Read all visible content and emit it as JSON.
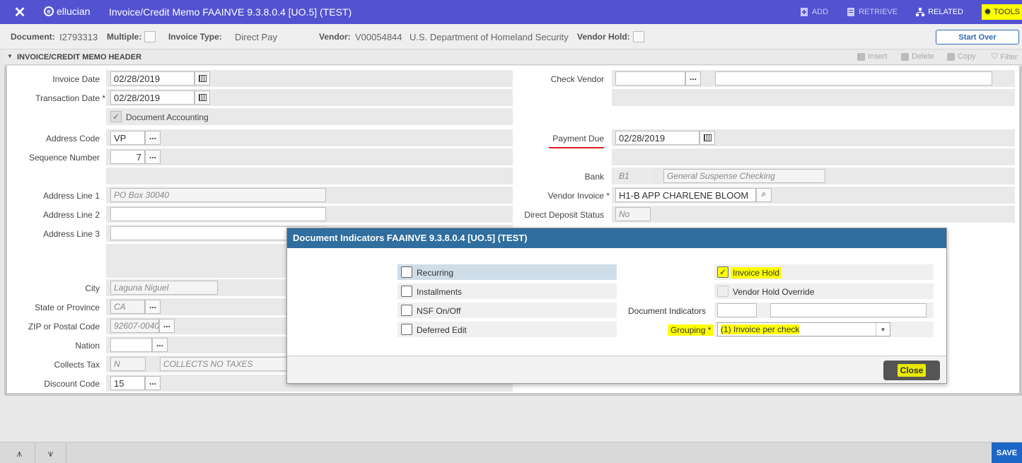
{
  "topbar": {
    "brand": "ellucian",
    "title": "Invoice/Credit Memo FAAINVE 9.3.8.0.4 [UO.5] (TEST)",
    "actions": {
      "add": "ADD",
      "retrieve": "RETRIEVE",
      "related": "RELATED",
      "tools": "TOOLS"
    }
  },
  "keyblock": {
    "document_label": "Document:",
    "document_value": "I2793313",
    "multiple_label": "Multiple:",
    "invoice_type_label": "Invoice Type:",
    "invoice_type_value": "Direct Pay",
    "vendor_label": "Vendor:",
    "vendor_id": "V00054844",
    "vendor_name": "U.S. Department of Homeland Security",
    "vendor_hold_label": "Vendor Hold:",
    "start_over": "Start Over"
  },
  "section": {
    "title": "INVOICE/CREDIT MEMO HEADER",
    "insert": "Insert",
    "delete": "Delete",
    "copy": "Copy",
    "filter": "Filter"
  },
  "form": {
    "invoice_date_label": "Invoice Date",
    "invoice_date": "02/28/2019",
    "transaction_date_label": "Transaction Date *",
    "transaction_date": "02/28/2019",
    "document_accounting_label": "Document Accounting",
    "address_code_label": "Address Code",
    "address_code": "VP",
    "sequence_number_label": "Sequence Number",
    "sequence_number": "7",
    "address_line1_label": "Address Line 1",
    "address_line1": "PO Box 30040",
    "address_line2_label": "Address Line 2",
    "address_line3_label": "Address Line 3",
    "city_label": "City",
    "city": "Laguna Niguel",
    "state_label": "State or Province",
    "state": "CA",
    "zip_label": "ZIP or Postal Code",
    "zip": "92607-0040",
    "nation_label": "Nation",
    "collects_tax_label": "Collects Tax",
    "collects_tax_code": "N",
    "collects_tax_desc": "COLLECTS NO TAXES",
    "discount_code_label": "Discount Code",
    "discount_code": "15",
    "check_vendor_label": "Check Vendor",
    "payment_due_label": "Payment Due",
    "payment_due": "02/28/2019",
    "bank_label": "Bank",
    "bank_code": "B1",
    "bank_desc": "General Suspense Checking",
    "vendor_invoice_label": "Vendor Invoice *",
    "vendor_invoice": "H1-B APP CHARLENE BLOOM",
    "direct_deposit_label": "Direct Deposit Status",
    "direct_deposit": "No"
  },
  "modal": {
    "title": "Document Indicators FAAINVE 9.3.8.0.4 [UO.5] (TEST)",
    "recurring": "Recurring",
    "installments": "Installments",
    "nsf": "NSF On/Off",
    "deferred_edit": "Deferred Edit",
    "invoice_hold": "Invoice Hold",
    "vendor_hold_override": "Vendor Hold Override",
    "document_indicators_label": "Document Indicators",
    "grouping_label": "Grouping *",
    "grouping_value": "(1) Invoice per check",
    "close": "Close"
  },
  "footer": {
    "save": "SAVE"
  }
}
